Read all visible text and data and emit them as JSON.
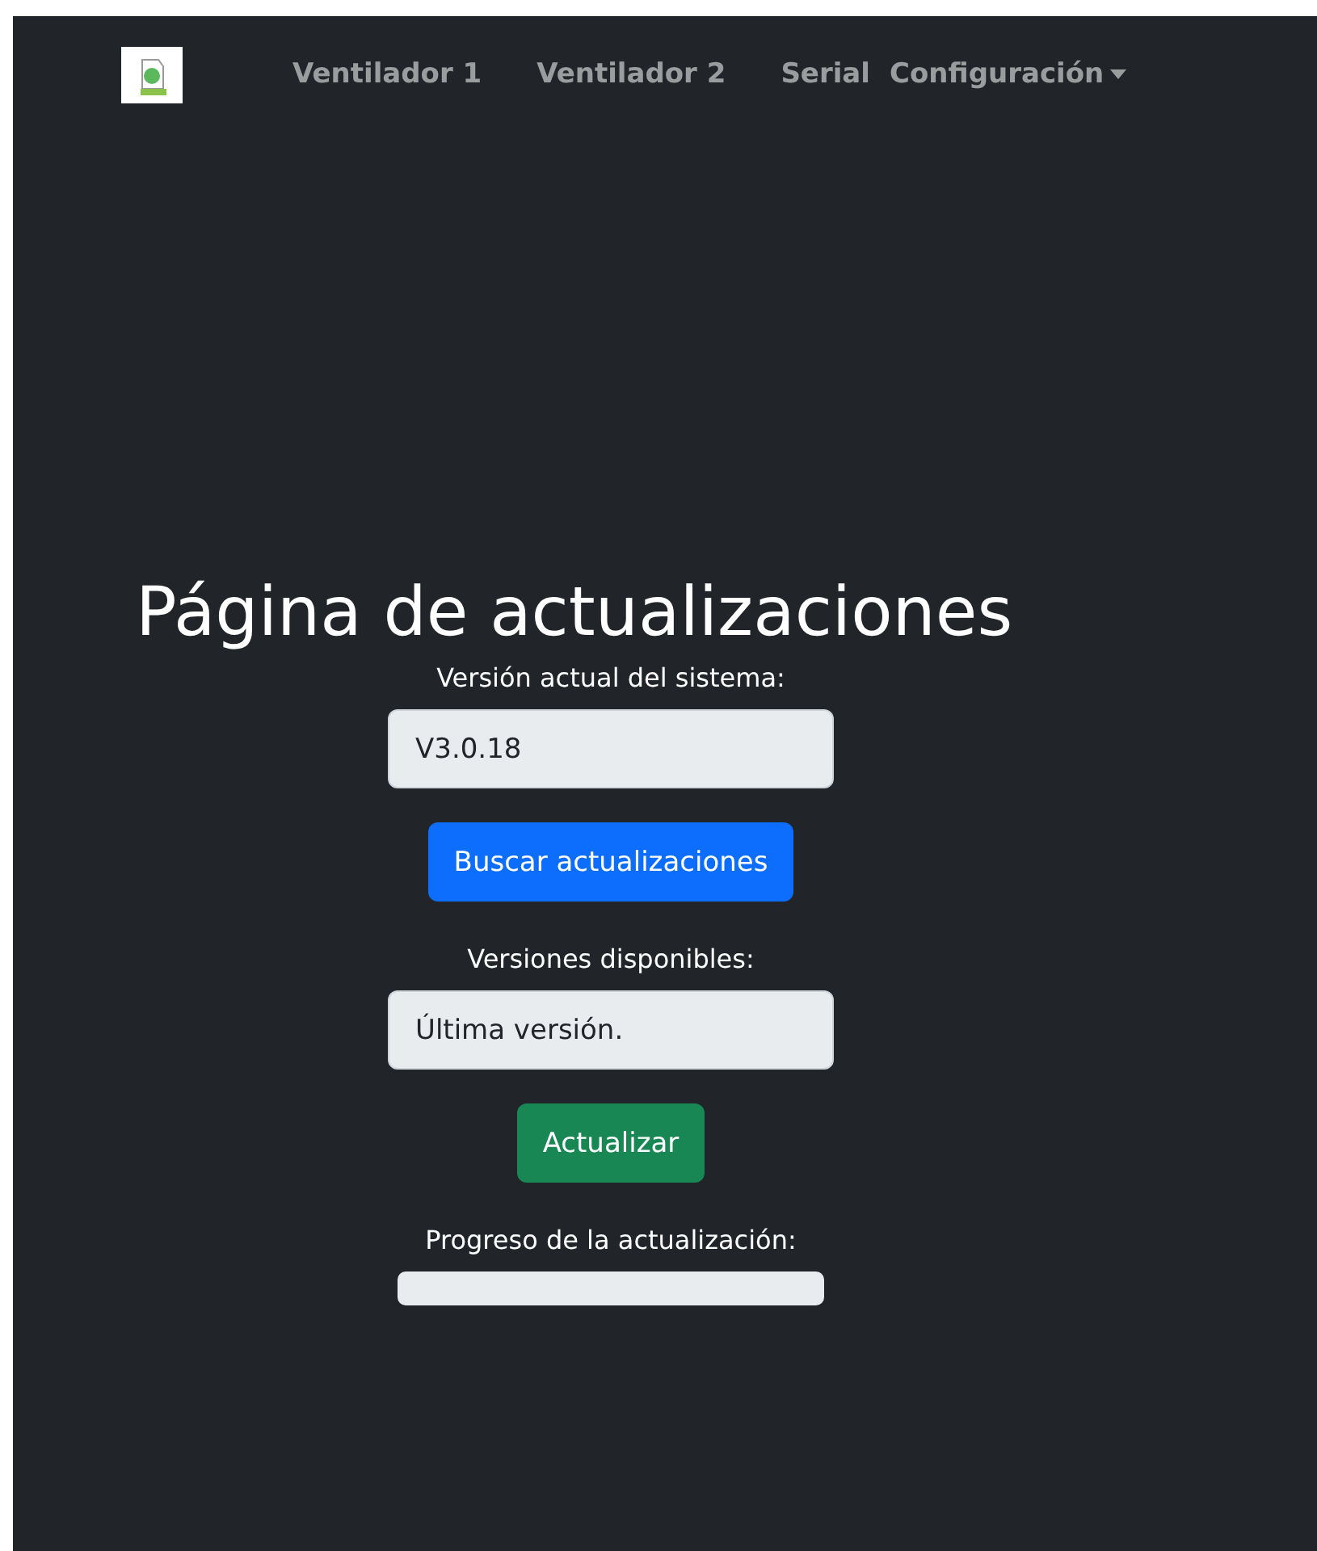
{
  "nav": {
    "items": [
      {
        "label": "Ventilador 1",
        "kind": "link"
      },
      {
        "label": "Ventilador 2",
        "kind": "link"
      },
      {
        "label": "Serial",
        "kind": "link"
      },
      {
        "label": "Configuración",
        "kind": "dropdown"
      }
    ]
  },
  "title": "Página de actualizaciones",
  "current_version": {
    "label": "Versión actual del sistema:",
    "value": "V3.0.18"
  },
  "search_button": "Buscar actualizaciones",
  "available": {
    "label": "Versiones disponibles:",
    "value": "Última versión."
  },
  "update_button": "Actualizar",
  "progress": {
    "label": "Progreso de la actualización:",
    "level": 0
  }
}
